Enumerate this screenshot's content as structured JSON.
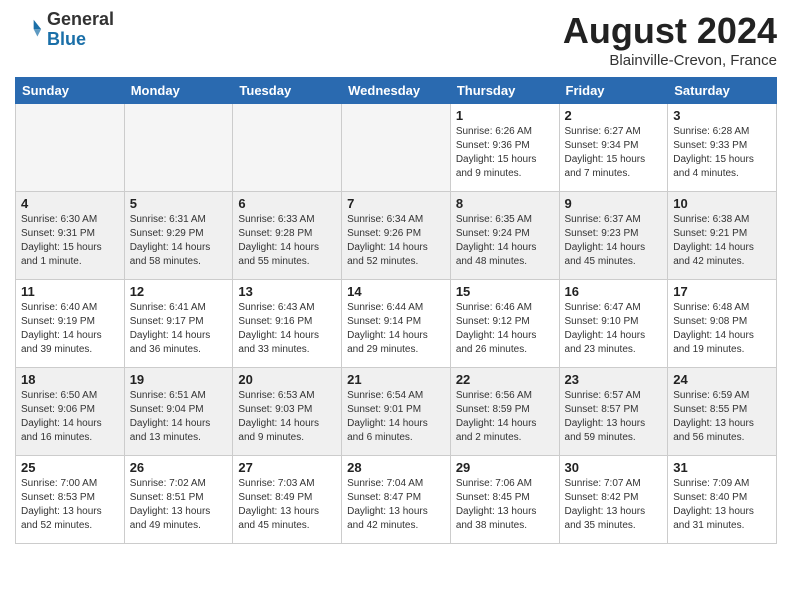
{
  "header": {
    "logo_general": "General",
    "logo_blue": "Blue",
    "month_year": "August 2024",
    "location": "Blainville-Crevon, France"
  },
  "days_of_week": [
    "Sunday",
    "Monday",
    "Tuesday",
    "Wednesday",
    "Thursday",
    "Friday",
    "Saturday"
  ],
  "weeks": [
    [
      {
        "day": "",
        "info": "",
        "empty": true
      },
      {
        "day": "",
        "info": "",
        "empty": true
      },
      {
        "day": "",
        "info": "",
        "empty": true
      },
      {
        "day": "",
        "info": "",
        "empty": true
      },
      {
        "day": "1",
        "info": "Sunrise: 6:26 AM\nSunset: 9:36 PM\nDaylight: 15 hours\nand 9 minutes.",
        "empty": false
      },
      {
        "day": "2",
        "info": "Sunrise: 6:27 AM\nSunset: 9:34 PM\nDaylight: 15 hours\nand 7 minutes.",
        "empty": false
      },
      {
        "day": "3",
        "info": "Sunrise: 6:28 AM\nSunset: 9:33 PM\nDaylight: 15 hours\nand 4 minutes.",
        "empty": false
      }
    ],
    [
      {
        "day": "4",
        "info": "Sunrise: 6:30 AM\nSunset: 9:31 PM\nDaylight: 15 hours\nand 1 minute.",
        "empty": false
      },
      {
        "day": "5",
        "info": "Sunrise: 6:31 AM\nSunset: 9:29 PM\nDaylight: 14 hours\nand 58 minutes.",
        "empty": false
      },
      {
        "day": "6",
        "info": "Sunrise: 6:33 AM\nSunset: 9:28 PM\nDaylight: 14 hours\nand 55 minutes.",
        "empty": false
      },
      {
        "day": "7",
        "info": "Sunrise: 6:34 AM\nSunset: 9:26 PM\nDaylight: 14 hours\nand 52 minutes.",
        "empty": false
      },
      {
        "day": "8",
        "info": "Sunrise: 6:35 AM\nSunset: 9:24 PM\nDaylight: 14 hours\nand 48 minutes.",
        "empty": false
      },
      {
        "day": "9",
        "info": "Sunrise: 6:37 AM\nSunset: 9:23 PM\nDaylight: 14 hours\nand 45 minutes.",
        "empty": false
      },
      {
        "day": "10",
        "info": "Sunrise: 6:38 AM\nSunset: 9:21 PM\nDaylight: 14 hours\nand 42 minutes.",
        "empty": false
      }
    ],
    [
      {
        "day": "11",
        "info": "Sunrise: 6:40 AM\nSunset: 9:19 PM\nDaylight: 14 hours\nand 39 minutes.",
        "empty": false
      },
      {
        "day": "12",
        "info": "Sunrise: 6:41 AM\nSunset: 9:17 PM\nDaylight: 14 hours\nand 36 minutes.",
        "empty": false
      },
      {
        "day": "13",
        "info": "Sunrise: 6:43 AM\nSunset: 9:16 PM\nDaylight: 14 hours\nand 33 minutes.",
        "empty": false
      },
      {
        "day": "14",
        "info": "Sunrise: 6:44 AM\nSunset: 9:14 PM\nDaylight: 14 hours\nand 29 minutes.",
        "empty": false
      },
      {
        "day": "15",
        "info": "Sunrise: 6:46 AM\nSunset: 9:12 PM\nDaylight: 14 hours\nand 26 minutes.",
        "empty": false
      },
      {
        "day": "16",
        "info": "Sunrise: 6:47 AM\nSunset: 9:10 PM\nDaylight: 14 hours\nand 23 minutes.",
        "empty": false
      },
      {
        "day": "17",
        "info": "Sunrise: 6:48 AM\nSunset: 9:08 PM\nDaylight: 14 hours\nand 19 minutes.",
        "empty": false
      }
    ],
    [
      {
        "day": "18",
        "info": "Sunrise: 6:50 AM\nSunset: 9:06 PM\nDaylight: 14 hours\nand 16 minutes.",
        "empty": false
      },
      {
        "day": "19",
        "info": "Sunrise: 6:51 AM\nSunset: 9:04 PM\nDaylight: 14 hours\nand 13 minutes.",
        "empty": false
      },
      {
        "day": "20",
        "info": "Sunrise: 6:53 AM\nSunset: 9:03 PM\nDaylight: 14 hours\nand 9 minutes.",
        "empty": false
      },
      {
        "day": "21",
        "info": "Sunrise: 6:54 AM\nSunset: 9:01 PM\nDaylight: 14 hours\nand 6 minutes.",
        "empty": false
      },
      {
        "day": "22",
        "info": "Sunrise: 6:56 AM\nSunset: 8:59 PM\nDaylight: 14 hours\nand 2 minutes.",
        "empty": false
      },
      {
        "day": "23",
        "info": "Sunrise: 6:57 AM\nSunset: 8:57 PM\nDaylight: 13 hours\nand 59 minutes.",
        "empty": false
      },
      {
        "day": "24",
        "info": "Sunrise: 6:59 AM\nSunset: 8:55 PM\nDaylight: 13 hours\nand 56 minutes.",
        "empty": false
      }
    ],
    [
      {
        "day": "25",
        "info": "Sunrise: 7:00 AM\nSunset: 8:53 PM\nDaylight: 13 hours\nand 52 minutes.",
        "empty": false
      },
      {
        "day": "26",
        "info": "Sunrise: 7:02 AM\nSunset: 8:51 PM\nDaylight: 13 hours\nand 49 minutes.",
        "empty": false
      },
      {
        "day": "27",
        "info": "Sunrise: 7:03 AM\nSunset: 8:49 PM\nDaylight: 13 hours\nand 45 minutes.",
        "empty": false
      },
      {
        "day": "28",
        "info": "Sunrise: 7:04 AM\nSunset: 8:47 PM\nDaylight: 13 hours\nand 42 minutes.",
        "empty": false
      },
      {
        "day": "29",
        "info": "Sunrise: 7:06 AM\nSunset: 8:45 PM\nDaylight: 13 hours\nand 38 minutes.",
        "empty": false
      },
      {
        "day": "30",
        "info": "Sunrise: 7:07 AM\nSunset: 8:42 PM\nDaylight: 13 hours\nand 35 minutes.",
        "empty": false
      },
      {
        "day": "31",
        "info": "Sunrise: 7:09 AM\nSunset: 8:40 PM\nDaylight: 13 hours\nand 31 minutes.",
        "empty": false
      }
    ]
  ]
}
